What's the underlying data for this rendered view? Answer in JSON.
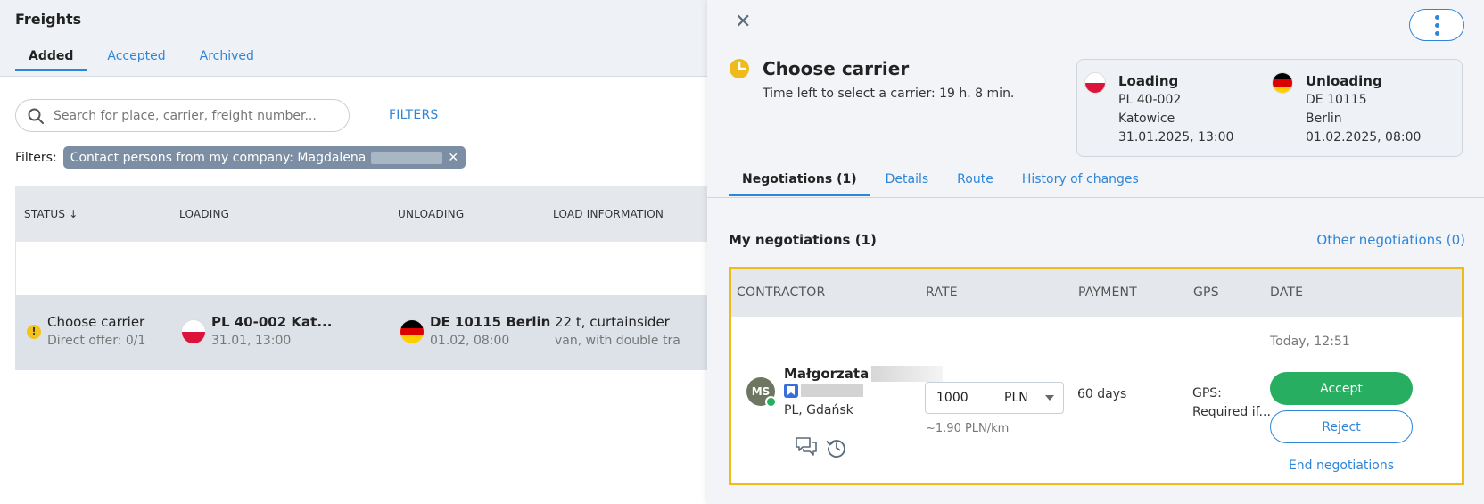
{
  "page": {
    "title": "Freights"
  },
  "tabs": [
    "Added",
    "Accepted",
    "Archived"
  ],
  "search": {
    "placeholder": "Search for place, carrier, freight number..."
  },
  "filters_link": "FILTERS",
  "filters": {
    "label": "Filters:",
    "chip": "Contact persons from my company: Magdalena"
  },
  "table": {
    "headers": {
      "status": "STATUS ↓",
      "loading": "LOADING",
      "unloading": "UNLOADING",
      "load_info": "LOAD INFORMATION"
    },
    "row": {
      "status_title": "Choose carrier",
      "status_sub": "Direct offer: 0/1",
      "loading_title": "PL 40-002 Kat...",
      "loading_sub": "31.01, 13:00",
      "unloading_title": "DE 10115 Berlin",
      "unloading_sub": "01.02, 08:00",
      "load_title": "22 t, curtainsider",
      "load_sub": "van, with double tra"
    }
  },
  "panel": {
    "title": "Choose carrier",
    "subtitle": "Time left to select a carrier: 19 h. 8 min.",
    "loading": {
      "heading": "Loading",
      "code": "PL 40-002",
      "city": "Katowice",
      "date": "31.01.2025, 13:00"
    },
    "unloading": {
      "heading": "Unloading",
      "code": "DE 10115",
      "city": "Berlin",
      "date": "01.02.2025, 08:00"
    },
    "tabs": [
      "Negotiations (1)",
      "Details",
      "Route",
      "History of changes"
    ],
    "my_negotiations": "My negotiations (1)",
    "other_negotiations": "Other negotiations (0)",
    "neg_headers": {
      "contractor": "CONTRACTOR",
      "rate": "RATE",
      "payment": "PAYMENT",
      "gps": "GPS",
      "date": "DATE"
    },
    "negotiation": {
      "initials": "MS",
      "name": "Małgorzata",
      "location": "PL, Gdańsk",
      "rate_value": "1000",
      "currency": "PLN",
      "rate_per_km": "~1.90 PLN/km",
      "payment": "60 days",
      "gps_label": "GPS:",
      "gps_value": "Required if...",
      "date": "Today, 12:51",
      "accept": "Accept",
      "reject": "Reject",
      "end": "End negotiations"
    }
  },
  "colors": {
    "accent": "#2f86d9",
    "accept": "#27ae60",
    "highlight": "#f0bb1a",
    "status": "#f5c218"
  },
  "icons": [
    "search-icon",
    "close-icon",
    "kebab-menu-icon",
    "clock-icon",
    "chat-icon",
    "history-icon",
    "verified-badge-icon",
    "chevron-down-icon",
    "warning-icon"
  ]
}
